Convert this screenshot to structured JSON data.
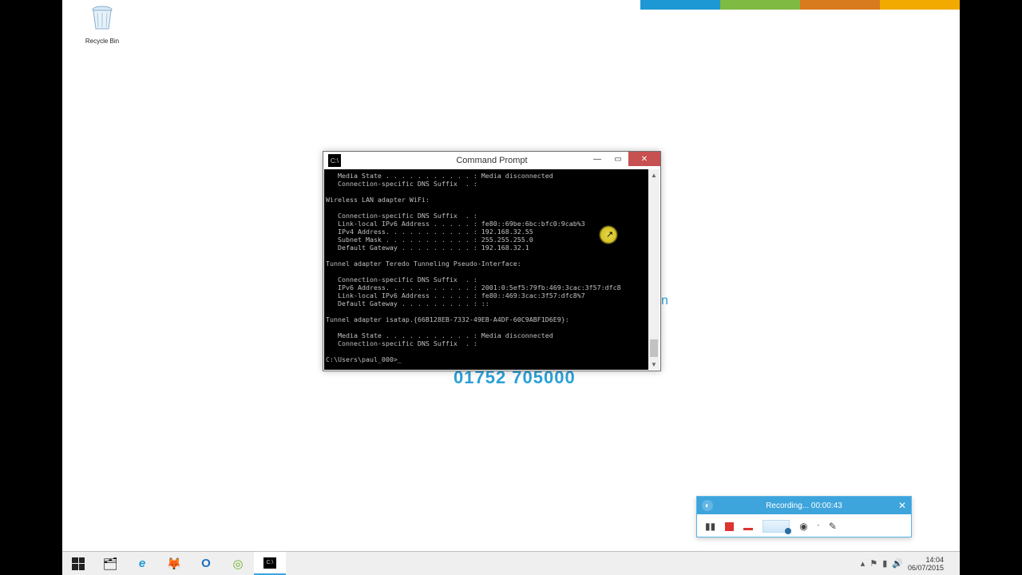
{
  "color_strip": [
    "#1e98d4",
    "#7fba42",
    "#d87a1e",
    "#f2a900"
  ],
  "recycle_bin": {
    "label": "Recycle Bin"
  },
  "background": {
    "phone": "01752 705000",
    "tagline_tail": "n"
  },
  "cmd": {
    "title": "Command Prompt",
    "lines": [
      "   Media State . . . . . . . . . . . : Media disconnected",
      "   Connection-specific DNS Suffix  . :",
      "",
      "Wireless LAN adapter WiFi:",
      "",
      "   Connection-specific DNS Suffix  . :",
      "   Link-local IPv6 Address . . . . . : fe80::69be:6bc:bfc0:9cab%3",
      "   IPv4 Address. . . . . . . . . . . : 192.168.32.55",
      "   Subnet Mask . . . . . . . . . . . : 255.255.255.0",
      "   Default Gateway . . . . . . . . . : 192.168.32.1",
      "",
      "Tunnel adapter Teredo Tunneling Pseudo-Interface:",
      "",
      "   Connection-specific DNS Suffix  . :",
      "   IPv6 Address. . . . . . . . . . . : 2001:0:5ef5:79fb:469:3cac:3f57:dfc8",
      "   Link-local IPv6 Address . . . . . : fe80::469:3cac:3f57:dfc8%7",
      "   Default Gateway . . . . . . . . . : ::",
      "",
      "Tunnel adapter isatap.{66B128EB-7332-49EB-A4DF-60C9ABF1D6E9}:",
      "",
      "   Media State . . . . . . . . . . . : Media disconnected",
      "   Connection-specific DNS Suffix  . :",
      "",
      "C:\\Users\\paul_000>_"
    ]
  },
  "recorder": {
    "title": "Recording... 00:00:43",
    "controls": {
      "pause": "pause",
      "stop": "stop",
      "mark": "marker",
      "wave": "audio-level",
      "webcam": "webcam",
      "draw": "draw"
    }
  },
  "taskbar": {
    "apps": [
      {
        "id": "start",
        "glyph": ""
      },
      {
        "id": "explorer",
        "glyph": "🗂"
      },
      {
        "id": "ie",
        "glyph": "e",
        "color": "#1e98d4"
      },
      {
        "id": "firefox",
        "glyph": "🦊"
      },
      {
        "id": "outlook",
        "glyph": "O",
        "color": "#1e6fbf"
      },
      {
        "id": "vmware",
        "glyph": "◎",
        "color": "#6fb22b"
      },
      {
        "id": "cmd",
        "glyph": "▮",
        "active": true
      }
    ],
    "tray": {
      "up": "▴",
      "flag": "⚑",
      "net": "▮",
      "vol": "🔊"
    },
    "clock": {
      "time": "14:04",
      "date": "06/07/2015"
    }
  }
}
